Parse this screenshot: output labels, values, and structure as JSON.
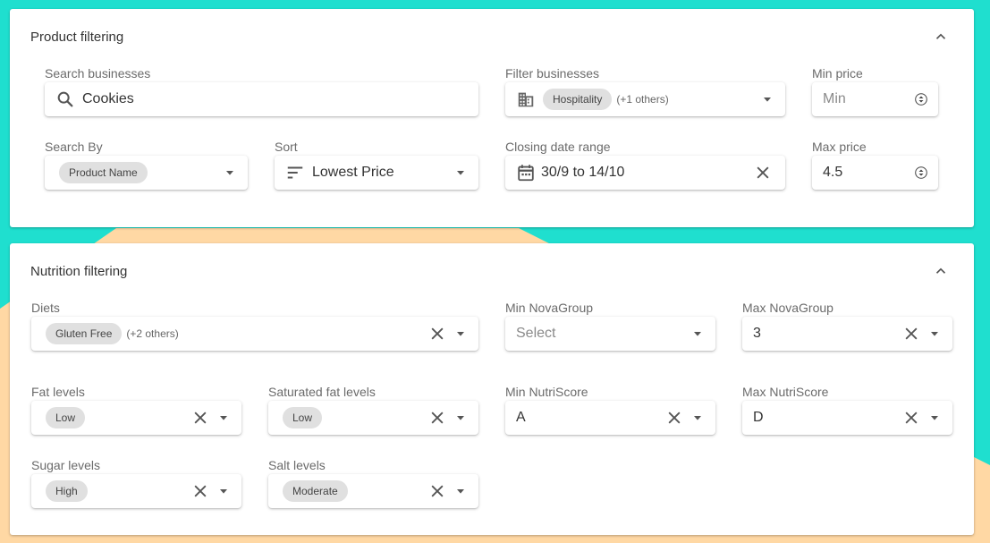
{
  "colors": {
    "bg_teal": "#1fdfcf",
    "bg_peach": "#ffd8a4",
    "chip": "#e0e0e0"
  },
  "product": {
    "title": "Product filtering",
    "search": {
      "label": "Search businesses",
      "value": "Cookies"
    },
    "filter_businesses": {
      "label": "Filter businesses",
      "chip": "Hospitality",
      "others": "(+1 others)"
    },
    "min_price": {
      "label": "Min price",
      "placeholder": "Min"
    },
    "search_by": {
      "label": "Search By",
      "chip": "Product Name"
    },
    "sort": {
      "label": "Sort",
      "value": "Lowest Price"
    },
    "closing_date": {
      "label": "Closing date range",
      "value": "30/9 to 14/10"
    },
    "max_price": {
      "label": "Max price",
      "value": "4.5"
    }
  },
  "nutrition": {
    "title": "Nutrition filtering",
    "diets": {
      "label": "Diets",
      "chip": "Gluten Free",
      "others": "(+2 others)"
    },
    "min_nova": {
      "label": "Min NovaGroup",
      "placeholder": "Select"
    },
    "max_nova": {
      "label": "Max NovaGroup",
      "value": "3"
    },
    "fat": {
      "label": "Fat levels",
      "chip": "Low"
    },
    "sat_fat": {
      "label": "Saturated fat levels",
      "chip": "Low"
    },
    "min_nutri": {
      "label": "Min NutriScore",
      "value": "A"
    },
    "max_nutri": {
      "label": "Max NutriScore",
      "value": "D"
    },
    "sugar": {
      "label": "Sugar levels",
      "chip": "High"
    },
    "salt": {
      "label": "Salt levels",
      "chip": "Moderate"
    }
  }
}
